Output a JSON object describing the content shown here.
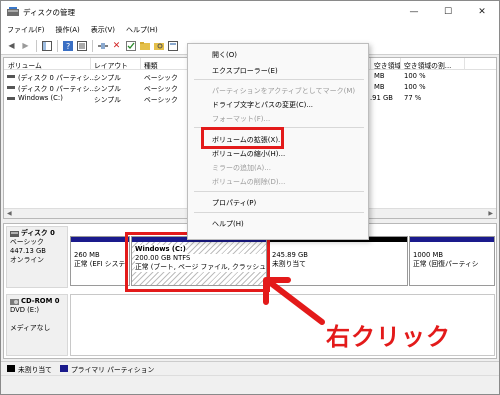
{
  "window": {
    "title": "ディスクの管理",
    "controls": [
      "—",
      "☐",
      "✕"
    ]
  },
  "menu": [
    "ファイル(F)",
    "操作(A)",
    "表示(V)",
    "ヘルプ(H)"
  ],
  "volume_list": {
    "columns": [
      "ボリューム",
      "レイアウト",
      "種類",
      "",
      "",
      "",
      "空き領域",
      "空き領域の割..."
    ],
    "rows": [
      {
        "name": "(ディスク 0 パーティシ...",
        "layout": "シンプル",
        "type": "ベーシック",
        "free": "MB",
        "pct": "100 %"
      },
      {
        "name": "(ディスク 0 パーティシ...",
        "layout": "シンプル",
        "type": "ベーシック",
        "free": "MB",
        "pct": "100 %"
      },
      {
        "name": "Windows (C:)",
        "layout": "シンプル",
        "type": "ベーシック",
        "free": ".91 GB",
        "pct": "77 %"
      }
    ]
  },
  "context_menu": {
    "open": "開く(O)",
    "explorer": "エクスプローラー(E)",
    "mark_active": "パーティションをアクティブとしてマーク(M)",
    "change_letter": "ドライブ文字とパスの変更(C)...",
    "format": "フォーマット(F)...",
    "extend": "ボリュームの拡張(X)...",
    "shrink": "ボリュームの縮小(H)...",
    "add_mirror": "ミラーの追加(A)...",
    "delete": "ボリュームの削除(D)...",
    "properties": "プロパティ(P)",
    "help": "ヘルプ(H)"
  },
  "disks": [
    {
      "label": "ディスク 0",
      "type": "ベーシック",
      "size": "447.13 GB",
      "status": "オンライン",
      "partitions": [
        {
          "line1": "260 MB",
          "line2": "正常 (EFI システ"
        },
        {
          "name": "Windows  (C:)",
          "line1": "200.00 GB NTFS",
          "line2": "正常 (ブート, ページ ファイル, クラッシュ ダン"
        },
        {
          "line1": "245.89 GB",
          "line2": "未割り当て"
        },
        {
          "line1": "1000 MB",
          "line2": "正常 (回復パーティシ"
        }
      ]
    },
    {
      "label": "CD-ROM 0",
      "type": "DVD (E:)",
      "status": "メディアなし"
    }
  ],
  "legend": [
    "未割り当て",
    "プライマリ パーティション"
  ],
  "annotation": "右クリック",
  "colors": {
    "unallocated": "#000000",
    "primary": "#1a1a8c",
    "highlight": "#e31a1a"
  }
}
